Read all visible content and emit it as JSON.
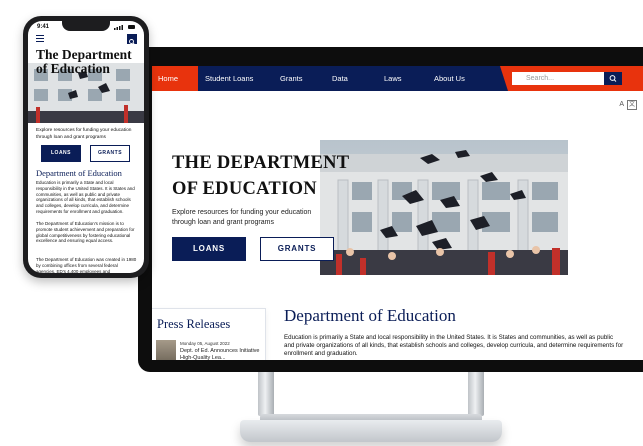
{
  "desktop": {
    "nav": {
      "items": [
        "Home",
        "Student Loans",
        "Grants",
        "Data",
        "Laws",
        "About Us"
      ],
      "search_placeholder": "Search..."
    },
    "a11y": {
      "text_size": "A",
      "translate": "文"
    },
    "hero": {
      "title_line1": "THE DEPARTMENT",
      "title_line2": "OF EDUCATION",
      "subtitle": "Explore resources for funding your education through loan and grant programs",
      "loans_label": "LOANS",
      "grants_label": "GRANTS"
    },
    "press": {
      "title": "Press Releases",
      "date": "Monday 05, August 2022",
      "headline": "Dept. of Ed. Announces Initiative High-Quality Lea..."
    },
    "department": {
      "title": "Department of Education",
      "body": "Education is primarily a State and local responsibility in the United States. It is States and communities, as well as public and private organizations of all kinds, that establish schools and colleges, develop curricula, and determine requirements for enrollment and graduation."
    }
  },
  "phone": {
    "status": {
      "time": "9:41"
    },
    "title": "The Department of Education",
    "subtitle": "Explore resources for funding your education through loan and grant programs",
    "loans_label": "LOANS",
    "grants_label": "GRANTS",
    "dept_title": "Department of Education",
    "p1": "Education is primarily a State and local responsibility in the United States. It is States and communities, as well as public and private organizations of all kinds, that establish schools and colleges, develop curricula, and determine requirements for enrollment and graduation.",
    "p2": "The Department of Education's mission is to promote student achievement and preparation for global competitiveness by fostering educational excellence and ensuring equal access.",
    "p3": "The Department of Education was created in 1980 by combining offices from several federal agencies. ED's 4,400 employees and"
  },
  "colors": {
    "navy": "#0a1d57",
    "orange": "#e8330d"
  }
}
